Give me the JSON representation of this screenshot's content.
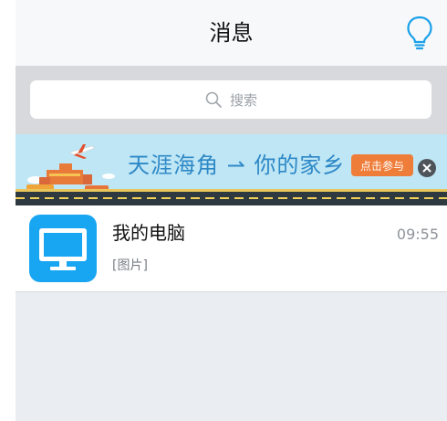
{
  "header": {
    "title": "消息",
    "right_icon": "lightbulb-icon"
  },
  "search": {
    "placeholder": "搜索",
    "icon": "search-icon"
  },
  "banner": {
    "text": "天涯海角 ⇀ 你的家乡",
    "button_label": "点击参与",
    "close_icon": "close-icon",
    "colors": {
      "background": "#bfe6f5",
      "text": "#2d88c6",
      "button": "#ef7d3a"
    }
  },
  "messages": [
    {
      "name": "我的电脑",
      "time": "09:55",
      "preview": "[图片]",
      "avatar_icon": "computer-monitor-icon",
      "avatar_color": "#18a6f2"
    }
  ]
}
